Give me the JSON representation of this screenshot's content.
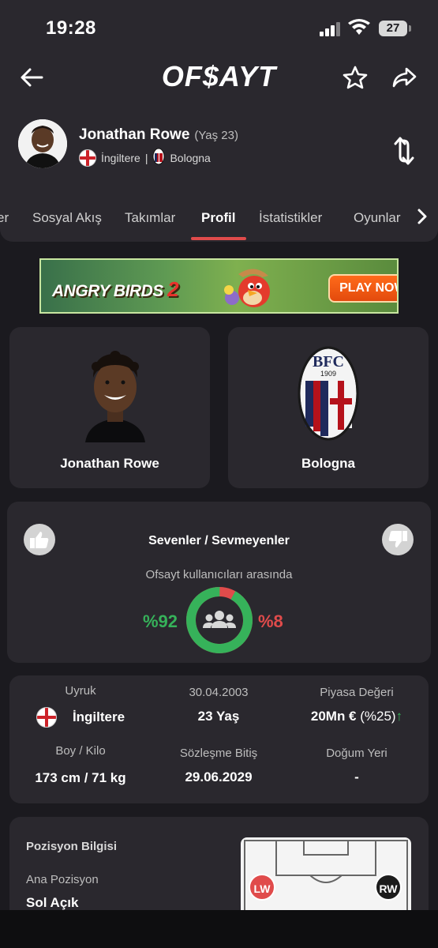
{
  "status": {
    "time": "19:28",
    "battery": "27"
  },
  "app": {
    "logo": "OF$AYT"
  },
  "player": {
    "name": "Jonathan Rowe",
    "age": "(Yaş 23)",
    "country": "İngiltere",
    "separator": "|",
    "club": "Bologna"
  },
  "tabs": [
    {
      "label": "er"
    },
    {
      "label": "Sosyal Akış"
    },
    {
      "label": "Takımlar"
    },
    {
      "label": "Profil"
    },
    {
      "label": "İstatistikler"
    },
    {
      "label": "Oyunlar"
    }
  ],
  "ad": {
    "title_a": "ANGRY BIRDS",
    "title_b": "2",
    "cta": "PLAY NOW!"
  },
  "cards": {
    "player_name": "Jonathan Rowe",
    "club_name": "Bologna",
    "club_crest_text": "BFC",
    "club_crest_year": "1909"
  },
  "likes": {
    "title": "Sevenler / Sevmeyenler",
    "subtitle": "Ofsayt kullanıcıları arasında",
    "like_pct": "%92",
    "dislike_pct": "%8",
    "like_fraction": 0.92
  },
  "info": {
    "nationality_label": "Uyruk",
    "nationality_value": "İngiltere",
    "birth_date": "30.04.2003",
    "age_value": "23 Yaş",
    "market_label": "Piyasa Değeri",
    "market_value": "20Mn €",
    "market_change": "(%25)",
    "height_label": "Boy / Kilo",
    "height_value": "173 cm / 71 kg",
    "contract_label": "Sözleşme Bitiş",
    "contract_value": "29.06.2029",
    "birthplace_label": "Doğum Yeri",
    "birthplace_value": "-"
  },
  "position": {
    "title": "Pozisyon Bilgisi",
    "main_label": "Ana Pozisyon",
    "main_value": "Sol Açık",
    "pos_left": "LW",
    "pos_right": "RW"
  },
  "colors": {
    "accent": "#e04b4b",
    "like": "#36b25a",
    "bg": "#1b1a1f",
    "card": "#2a282e"
  }
}
